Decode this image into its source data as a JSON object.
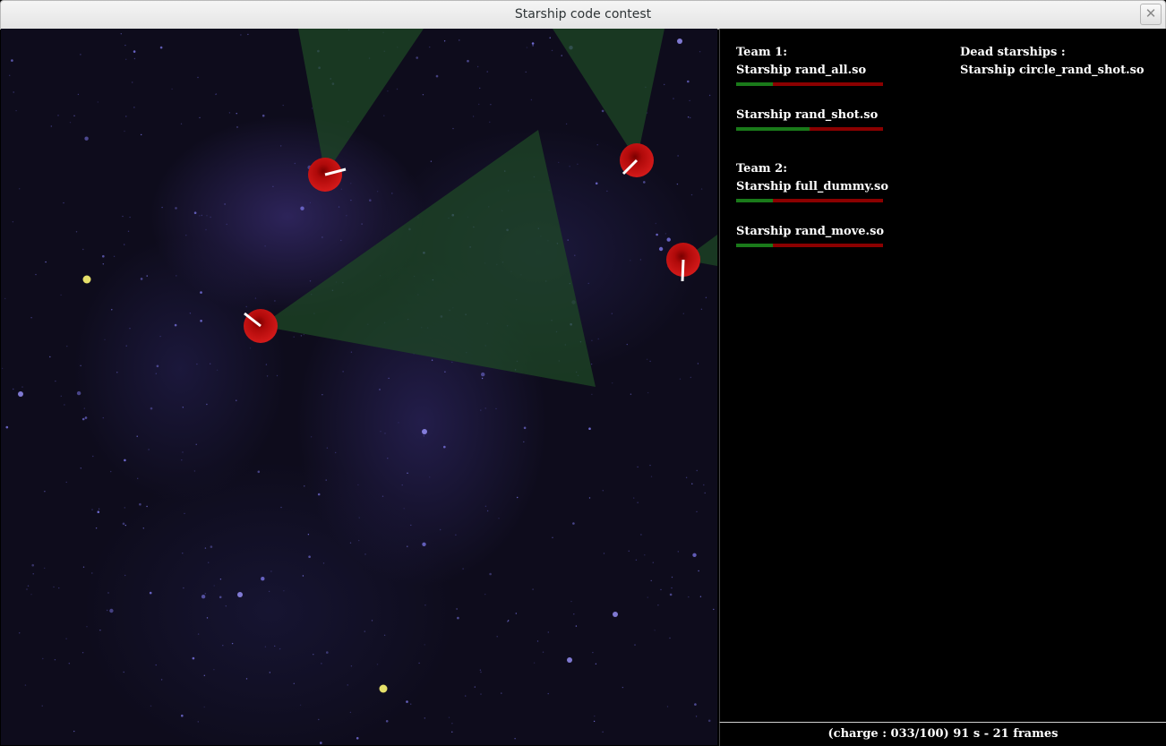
{
  "window": {
    "title": "Starship code contest",
    "close_glyph": "✕"
  },
  "teams": [
    {
      "label": "Team 1:",
      "ships": [
        {
          "name": "Starship rand_all.so",
          "health": 0.25
        },
        {
          "name": "Starship rand_shot.so",
          "health": 0.5
        }
      ]
    },
    {
      "label": "Team 2:",
      "ships": [
        {
          "name": "Starship full_dummy.so",
          "health": 0.25
        },
        {
          "name": "Starship rand_move.so",
          "health": 0.25
        }
      ]
    }
  ],
  "dead": {
    "label": "Dead starships :",
    "ships": [
      "Starship circle_rand_shot.so"
    ]
  },
  "status": {
    "text": "(charge : 033/100)  91 s - 21 frames"
  },
  "colors": {
    "ship": "#c41010",
    "health_good": "#1a7a1a",
    "health_bad": "#8b0000",
    "radar_cone": "#1e4a26",
    "bullet": "#e6e06a"
  }
}
